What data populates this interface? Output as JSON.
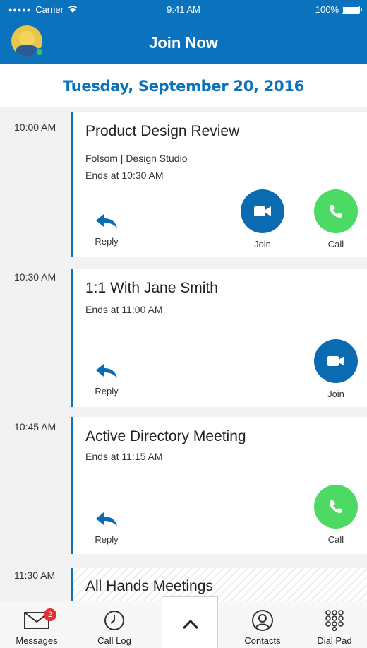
{
  "status_bar": {
    "carrier": "Carrier",
    "time": "9:41 AM",
    "battery": "100%"
  },
  "header": {
    "title": "Join Now"
  },
  "date": "Tuesday, September 20, 2016",
  "meetings": [
    {
      "time": "10:00 AM",
      "title": "Product Design Review",
      "location": "Folsom | Design Studio",
      "ends": "Ends at 10:30 AM",
      "reply_label": "Reply",
      "join_label": "Join",
      "call_label": "Call"
    },
    {
      "time": "10:30 AM",
      "title": "1:1 With Jane Smith",
      "ends": "Ends at 11:00 AM",
      "reply_label": "Reply",
      "join_label": "Join"
    },
    {
      "time": "10:45 AM",
      "title": "Active Directory Meeting",
      "ends": "Ends at 11:15 AM",
      "reply_label": "Reply",
      "call_label": "Call"
    },
    {
      "time": "11:30 AM",
      "title": "All Hands Meetings"
    }
  ],
  "tabbar": {
    "messages": {
      "label": "Messages",
      "badge": "2"
    },
    "call_log": {
      "label": "Call Log"
    },
    "contacts": {
      "label": "Contacts"
    },
    "dial_pad": {
      "label": "Dial Pad"
    }
  },
  "colors": {
    "brand": "#0b72bd",
    "join": "#0b6bb0",
    "call": "#4cd964",
    "badge": "#e03030"
  }
}
